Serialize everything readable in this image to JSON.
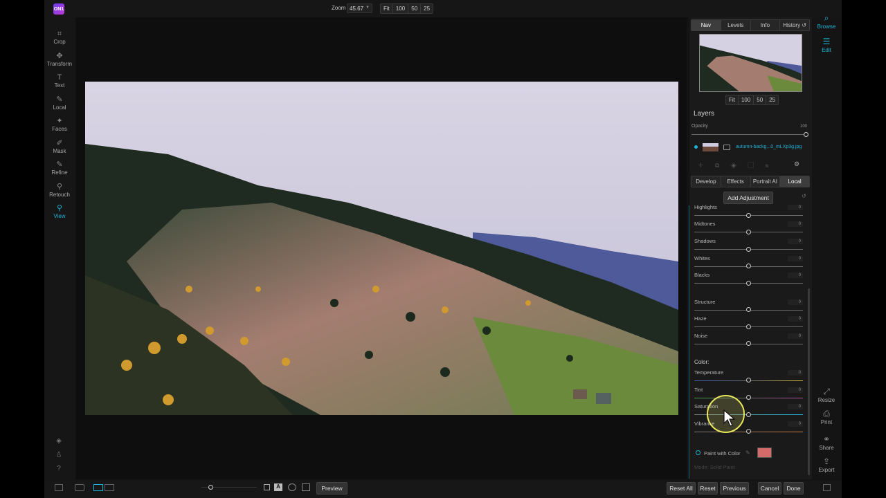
{
  "app": {
    "logo_text": "ON1"
  },
  "zoom": {
    "label": "Zoom",
    "value": "45.67",
    "presets": [
      "Fit",
      "100",
      "50",
      "25"
    ]
  },
  "left_tools": [
    {
      "label": "Crop",
      "icon": "crop-icon"
    },
    {
      "label": "Transform",
      "icon": "transform-icon"
    },
    {
      "label": "Text",
      "icon": "text-icon"
    },
    {
      "label": "Local",
      "icon": "brush-icon"
    },
    {
      "label": "Faces",
      "icon": "faces-icon"
    },
    {
      "label": "Mask",
      "icon": "mask-icon"
    },
    {
      "label": "Refine",
      "icon": "refine-icon"
    },
    {
      "label": "Retouch",
      "icon": "retouch-icon"
    },
    {
      "label": "View",
      "icon": "view-icon",
      "active": true
    }
  ],
  "right_tools": {
    "top": [
      {
        "label": "Browse",
        "icon": "browse-icon"
      },
      {
        "label": "Edit",
        "icon": "edit-icon",
        "active": true
      }
    ],
    "bottom": [
      {
        "label": "Resize",
        "icon": "resize-icon"
      },
      {
        "label": "Print",
        "icon": "print-icon"
      },
      {
        "label": "Share",
        "icon": "share-icon"
      },
      {
        "label": "Export",
        "icon": "export-icon"
      }
    ]
  },
  "nav_tabs": [
    "Nav",
    "Levels",
    "Info",
    "History"
  ],
  "nav_zoom_presets": [
    "Fit",
    "100",
    "50",
    "25"
  ],
  "layers": {
    "title": "Layers",
    "opacity_label": "Opacity",
    "opacity_value": "100",
    "opacity_fraction": 1.0,
    "layer_name": "autumn-backg...0_mLXp3g.jpg"
  },
  "module_tabs": [
    "Develop",
    "Effects",
    "Portrait AI",
    "Local"
  ],
  "add_adjustment": "Add Adjustment",
  "adjustments": [
    {
      "label": "Highlights",
      "value": "0"
    },
    {
      "label": "Midtones",
      "value": "0"
    },
    {
      "label": "Shadows",
      "value": "0"
    },
    {
      "label": "Whites",
      "value": "0"
    },
    {
      "label": "Blacks",
      "value": "0"
    },
    {
      "label": "Structure",
      "value": "0"
    },
    {
      "label": "Haze",
      "value": "0"
    },
    {
      "label": "Noise",
      "value": "0"
    }
  ],
  "color": {
    "title": "Color:",
    "sliders": [
      {
        "label": "Temperature",
        "value": "0"
      },
      {
        "label": "Tint",
        "value": "0"
      },
      {
        "label": "Saturation",
        "value": "0"
      },
      {
        "label": "Vibrance",
        "value": "0"
      }
    ]
  },
  "paint": {
    "label": "Paint with Color",
    "swatch": "#d46a6a",
    "mode": "Mode: Solid Paint"
  },
  "bottom": {
    "preview": "Preview",
    "buttons": [
      "Reset All",
      "Reset",
      "Previous",
      "Cancel",
      "Done"
    ]
  },
  "colors": {
    "accent": "#1fb3d6",
    "panel": "#1a1a1a",
    "canvas": "#0e0e0e"
  }
}
